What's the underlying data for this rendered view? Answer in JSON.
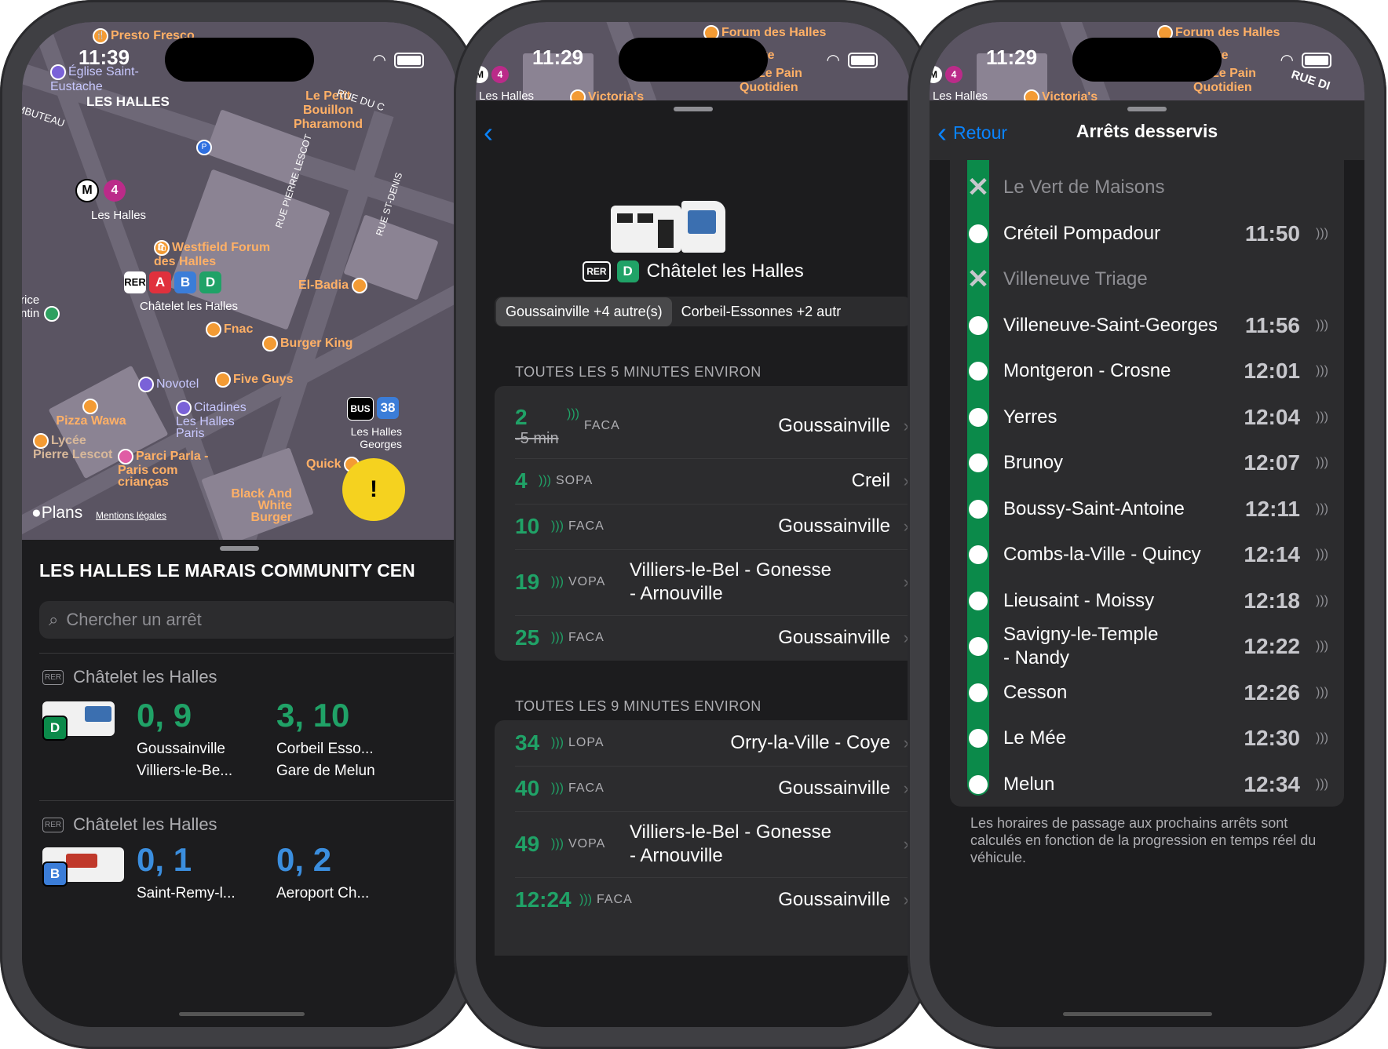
{
  "phone1": {
    "time": "11:39",
    "map": {
      "labels": {
        "presto": "Presto Fresco",
        "eglise": "Église Saint-Eustache",
        "leshalles_area": "LES HALLES",
        "petit_bouillon": "Le Petit Bouillon Pharamond",
        "rue_du": "RUE DU C",
        "mbuteau": "MBUTEAU",
        "metro_station": "Les Halles",
        "metro_line": "4",
        "metro_mark": "M",
        "westfield": "Westfield Forum des Halles",
        "rue_pierre_lescot": "RUE PIERRE LESCOT",
        "rue_st_denis": "RUE ST-DENIS",
        "rer_label": "RER",
        "rer_a": "A",
        "rer_b": "B",
        "rer_d": "D",
        "chatelet": "Châtelet les Halles",
        "el_badia": "El-Badia",
        "fnac": "Fnac",
        "burger_king": "Burger King",
        "rice": "rice",
        "ntin": "ntin",
        "novotel": "Novotel",
        "five_guys": "Five Guys",
        "pizza_wawa": "Pizza Wawa",
        "citadines": "Citadines Les Halles Paris",
        "lycee": "Lycée Pierre Lescot",
        "bus_label": "BUS",
        "bus_line": "38",
        "bus_stop": "Les Halles Georges",
        "parci_parla": "Parci Parla - Paris com crianças",
        "quick": "Quick",
        "black_and_white": "Black And White Burger",
        "plans": "Plans",
        "mentions": "Mentions légales",
        "parking": "P"
      },
      "alert_icon": "!"
    },
    "sheet": {
      "title": "LES HALLES LE MARAIS COMMUNITY CEN",
      "search_placeholder": "Chercher un arrêt",
      "sections": [
        {
          "mode": "RER",
          "name": "Châtelet les Halles",
          "line": "D",
          "color": "#0b8a4a",
          "departures": [
            {
              "minutes": "0, 9",
              "dest1": "Goussainville",
              "dest2": "Villiers-le-Be..."
            },
            {
              "minutes": "3, 10",
              "dest1": "Corbeil Esso...",
              "dest2": "Gare de Melun"
            }
          ]
        },
        {
          "mode": "RER",
          "name": "Châtelet les Halles",
          "line": "B",
          "color": "#3b7dd8",
          "departures": [
            {
              "minutes": "0, 1",
              "dest1": "Saint-Remy-l..."
            },
            {
              "minutes": "0, 2",
              "dest1": "Aeroport Ch..."
            }
          ]
        }
      ]
    }
  },
  "phone2": {
    "time": "11:29",
    "map_labels": {
      "forum": "Forum des Halles",
      "lacoste": "Lacoste",
      "le_pain": "Le Pain Quotidien",
      "les_halles": "Les Halles",
      "victorias": "Victoria's",
      "metro_line": "4",
      "metro_mark": "M"
    },
    "station": {
      "mode": "RER",
      "line": "D",
      "name": "Châtelet les Halles"
    },
    "segments": [
      "Goussainville +4 autre(s)",
      "Corbeil-Essonnes +2 autr"
    ],
    "groups": [
      {
        "header": "TOUTES LES 5 MINUTES ENVIRON",
        "rows": [
          {
            "min": "2",
            "sub": "-5 min",
            "code": "FACA",
            "dest": "Goussainville"
          },
          {
            "min": "4",
            "code": "SOPA",
            "dest": "Creil"
          },
          {
            "min": "10",
            "code": "FACA",
            "dest": "Goussainville"
          },
          {
            "min": "19",
            "code": "VOPA",
            "dest": "Villiers-le-Bel - Gonesse",
            "dest2": "- Arnouville"
          },
          {
            "min": "25",
            "code": "FACA",
            "dest": "Goussainville"
          }
        ]
      },
      {
        "header": "TOUTES LES 9 MINUTES ENVIRON",
        "rows": [
          {
            "min": "34",
            "code": "LOPA",
            "dest": "Orry-la-Ville - Coye"
          },
          {
            "min": "40",
            "code": "FACA",
            "dest": "Goussainville"
          },
          {
            "min": "49",
            "code": "VOPA",
            "dest": "Villiers-le-Bel - Gonesse",
            "dest2": "- Arnouville"
          },
          {
            "min": "12:24",
            "code": "FACA",
            "dest": "Goussainville"
          }
        ]
      }
    ]
  },
  "phone3": {
    "time": "11:29",
    "map_labels": {
      "forum": "Forum des Halles",
      "lacoste": "Lacoste",
      "le_pain": "Le Pain Quotidien",
      "les_halles": "Les Halles",
      "victorias": "Victoria's",
      "rue": "RUE DI",
      "metro_line": "4",
      "metro_mark": "M"
    },
    "nav": {
      "back": "Retour",
      "title": "Arrêts desservis"
    },
    "line_color": "#0b8a4a",
    "stops": [
      {
        "name": "Le Vert de Maisons",
        "time": "",
        "skipped": true
      },
      {
        "name": "Créteil Pompadour",
        "time": "11:50"
      },
      {
        "name": "Villeneuve Triage",
        "time": "",
        "skipped": true
      },
      {
        "name": "Villeneuve-Saint-Georges",
        "time": "11:56"
      },
      {
        "name": "Montgeron - Crosne",
        "time": "12:01"
      },
      {
        "name": "Yerres",
        "time": "12:04"
      },
      {
        "name": "Brunoy",
        "time": "12:07"
      },
      {
        "name": "Boussy-Saint-Antoine",
        "time": "12:11"
      },
      {
        "name": "Combs-la-Ville - Quincy",
        "time": "12:14"
      },
      {
        "name": "Lieusaint - Moissy",
        "time": "12:18"
      },
      {
        "name": "Savigny-le-Temple",
        "name2": "- Nandy",
        "time": "12:22"
      },
      {
        "name": "Cesson",
        "time": "12:26"
      },
      {
        "name": "Le Mée",
        "time": "12:30"
      },
      {
        "name": "Melun",
        "time": "12:34"
      }
    ],
    "footnote": "Les horaires de passage aux prochains arrêts sont calculés en fonction de la progression en temps réel du véhicule."
  }
}
